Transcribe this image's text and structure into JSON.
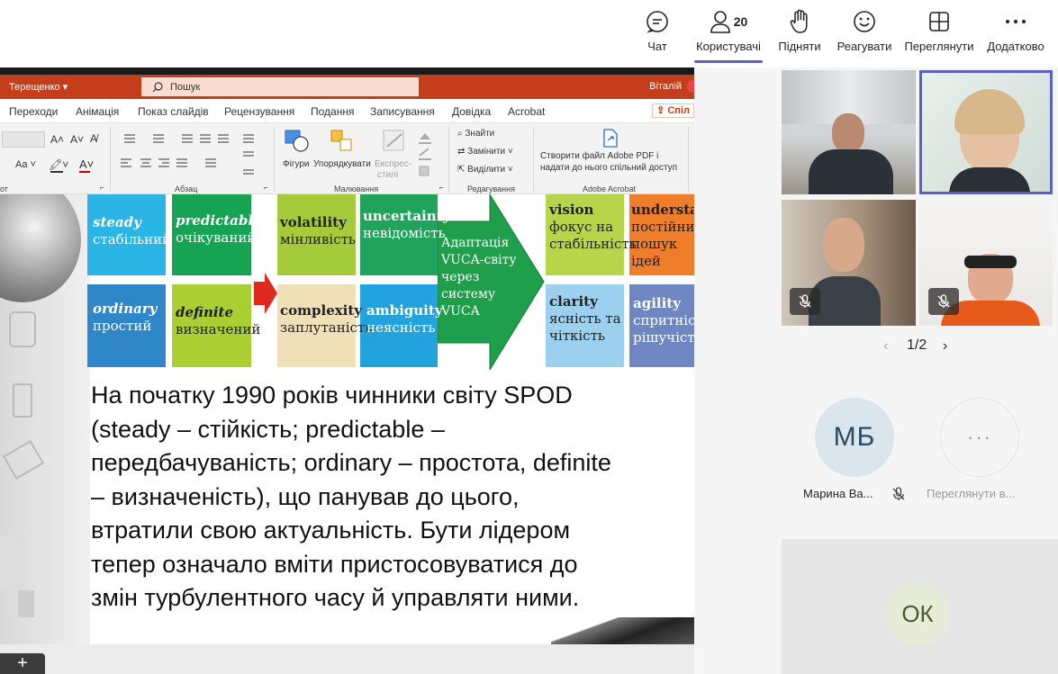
{
  "toolbar": {
    "chat_label": "Чат",
    "people_label": "Користувачі",
    "people_count": "20",
    "raise_label": "Підняти",
    "react_label": "Реагувати",
    "view_label": "Переглянути",
    "more_label": "Додатково"
  },
  "powerpoint": {
    "user_left": "Терещенко ▾",
    "search_placeholder": "Пошук",
    "user_right": "Віталій",
    "tabs": [
      "Переходи",
      "Анімація",
      "Показ слайдів",
      "Рецензування",
      "Подання",
      "Записування",
      "Довідка",
      "Acrobat"
    ],
    "share_label": "Спіл",
    "ribbon": {
      "group_font": "от",
      "group_paragraph": "Абзац",
      "group_drawing": "Малювання",
      "group_editing": "Редагування",
      "group_acrobat": "Adobe Acrobat",
      "shapes": "Фігури",
      "arrange": "Упорядкувати",
      "express": "Експрес-",
      "styles": "стилі",
      "find": "Знайти",
      "replace": "Замінити",
      "select": "Виділити",
      "acrobat_line1": "Створити файл Adobe PDF і",
      "acrobat_line2": "надати до нього спільний доступ"
    }
  },
  "slide": {
    "boxes": {
      "steady_en": "steady",
      "steady_ua": "стабільний",
      "predictable_en": "predictable",
      "predictable_ua": "очікуваний",
      "ordinary_en": "ordinary",
      "ordinary_ua": "простий",
      "definite_en": "definite",
      "definite_ua": "визначений",
      "volatility_en": "volatility",
      "volatility_ua": "мінливість",
      "uncertainty_en": "uncertainty",
      "uncertainty_ua": "невідомість",
      "complexity_en": "complexity",
      "complexity_ua": "заплутаність",
      "ambiguity_en": "ambiguity",
      "ambiguity_ua": "неясність",
      "arrow_text": "Адаптація VUCA-світу через систему VUCA",
      "vision_en": "vision",
      "vision_ua": "фокус на стабільність",
      "understand_en": "understand",
      "understand_ua": "постійний пошук ідей",
      "clarity_en": "clarity",
      "clarity_ua": "ясність та чіткість",
      "agility_en": "agility",
      "agility_ua": "спритність рішучість"
    },
    "body_lines": [
      "На початку 1990 років чинники світу SPOD",
      "(steady – стійкість; predictable –",
      "передбачуваність; ordinary – простота, definite",
      "– визначеність), що панував до цього,",
      "втратили свою актуальність. Бути лідером",
      "тепер означало вміти пристосовуватися до",
      "змін турбулентного часу й управляти ними."
    ],
    "add_label": "+"
  },
  "participants": {
    "pager": "1/2",
    "avatar1_initials": "МБ",
    "avatar1_name": "Марина Ва...",
    "avatar2_name": "Переглянути в...",
    "avatar2_initials": "···",
    "avatar3_initials": "ОК"
  },
  "colors": {
    "accent": "#5b5fc7",
    "powerpoint": "#c43e1c"
  }
}
